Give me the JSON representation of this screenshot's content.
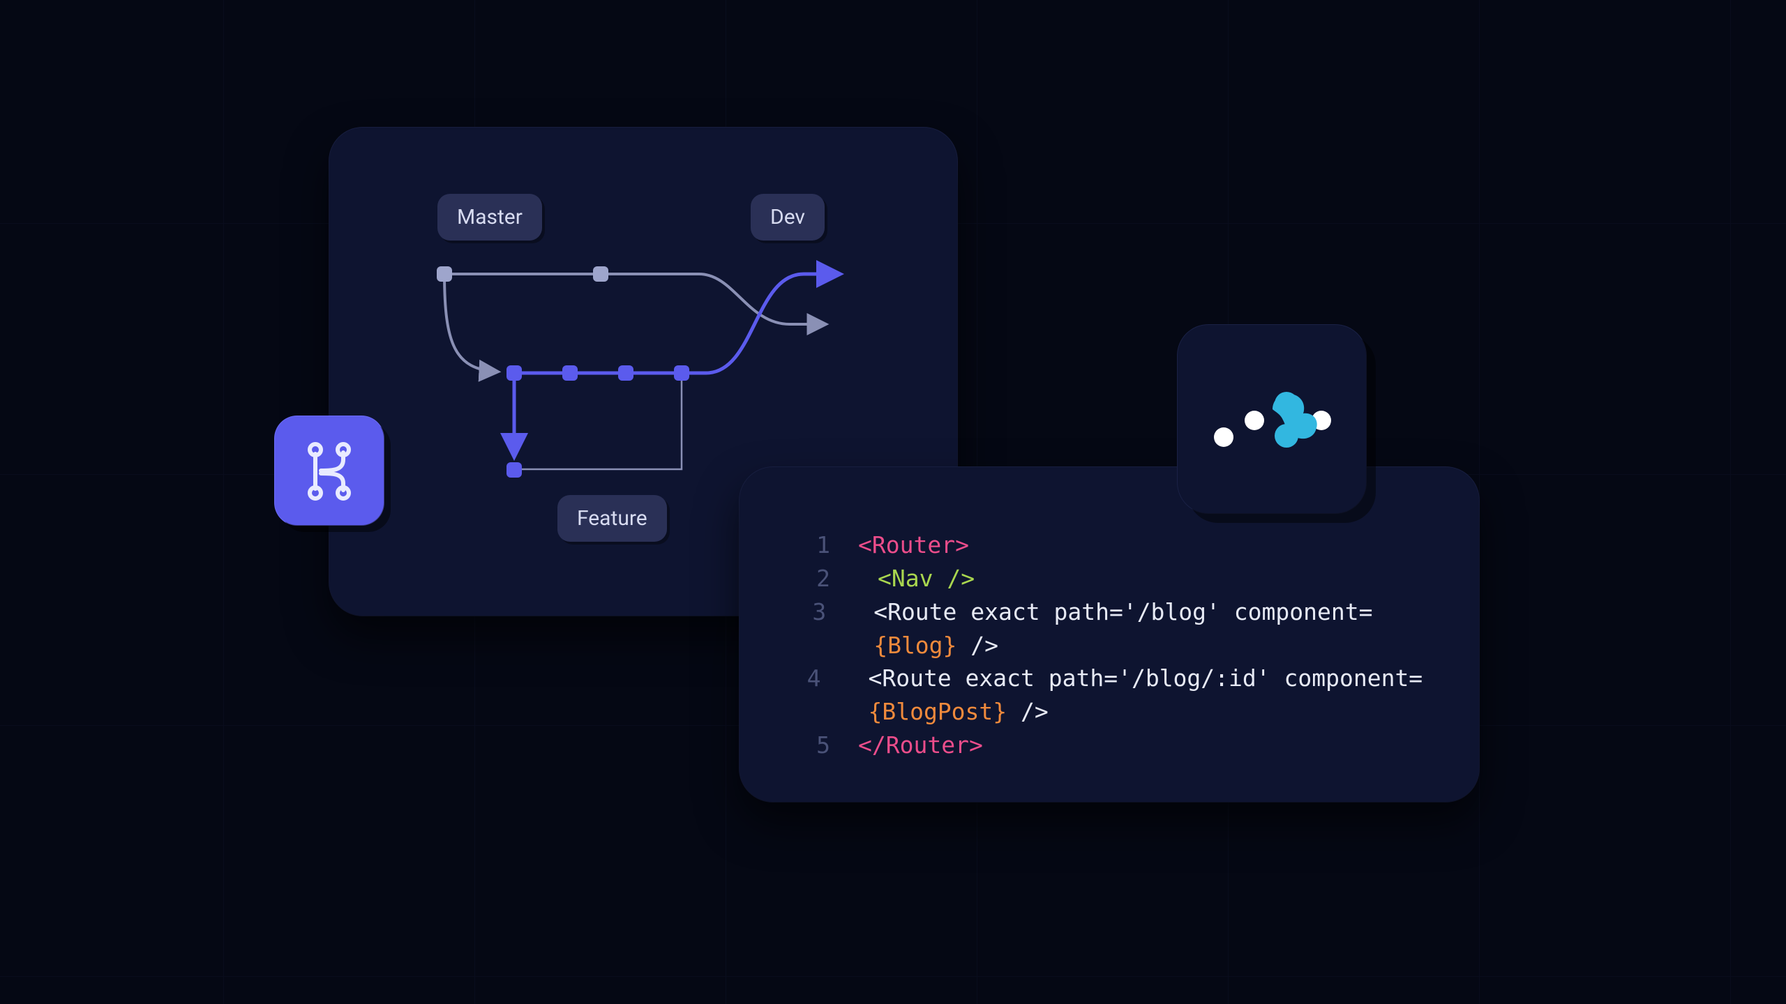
{
  "git_diagram": {
    "labels": {
      "master": "Master",
      "dev": "Dev",
      "feature": "Feature"
    },
    "icon": "git-branch-icon"
  },
  "logo": {
    "name": "react-router-logo"
  },
  "code": {
    "lines": [
      {
        "n": "1",
        "indent": 0,
        "tokens": [
          {
            "cls": "tok-tag",
            "t": "<Router>"
          }
        ]
      },
      {
        "n": "2",
        "indent": 1,
        "tokens": [
          {
            "cls": "tok-green",
            "t": "<Nav />"
          }
        ]
      },
      {
        "n": "3",
        "indent": 1,
        "tokens": [
          {
            "cls": "tok-white",
            "t": "<Route exact path='/blog' component="
          },
          {
            "cls": "tok-orange",
            "t": "{Blog}"
          },
          {
            "cls": "tok-white",
            "t": " />"
          }
        ]
      },
      {
        "n": "4",
        "indent": 1,
        "tokens": [
          {
            "cls": "tok-white",
            "t": "<Route exact path='/blog/:id' component="
          },
          {
            "cls": "tok-orange",
            "t": "{BlogPost}"
          },
          {
            "cls": "tok-white",
            "t": " />"
          }
        ]
      },
      {
        "n": "5",
        "indent": 0,
        "tokens": [
          {
            "cls": "tok-tag",
            "t": "</Router>"
          }
        ]
      }
    ]
  }
}
